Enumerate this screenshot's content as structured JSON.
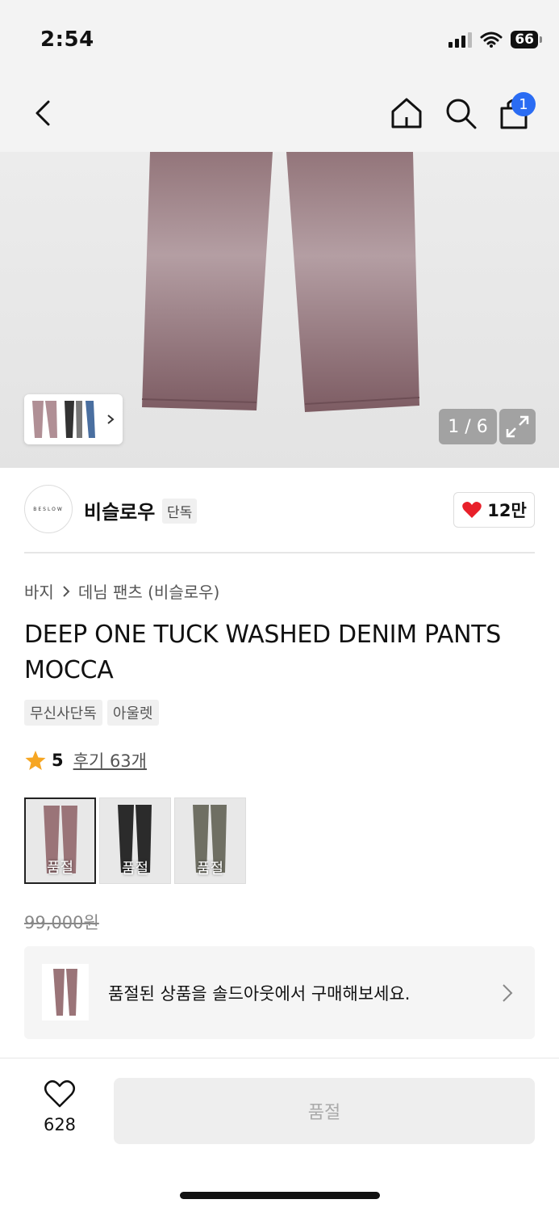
{
  "status_bar": {
    "time": "2:54",
    "battery": "66"
  },
  "nav": {
    "cart_count": "1"
  },
  "gallery": {
    "counter": "1 / 6"
  },
  "brand": {
    "logo_text": "BESLOW",
    "name": "비슬로우",
    "tag": "단독",
    "likes": "12만"
  },
  "breadcrumb": [
    "바지",
    "데님 팬츠 (비슬로우)"
  ],
  "product": {
    "title_line1": "DEEP ONE TUCK WASHED DENIM PANTS",
    "title_line2": "MOCCA",
    "tags": [
      "무신사단독",
      "아울렛"
    ],
    "rating": "5",
    "review_link": "후기 63개",
    "original_price": "99,000원"
  },
  "swatches": [
    {
      "label": "품절",
      "color": "#9a7478"
    },
    {
      "label": "품절",
      "color": "#2b2b2b"
    },
    {
      "label": "품절",
      "color": "#6f6f63"
    }
  ],
  "banner": {
    "text": "품절된 상품을 솔드아웃에서 구매해보세요."
  },
  "bottom": {
    "wish_count": "628",
    "buy_label": "품절"
  },
  "colors": {
    "accent_blue": "#2a6cf3",
    "heart_red": "#e8202a",
    "star": "#f6a623"
  }
}
